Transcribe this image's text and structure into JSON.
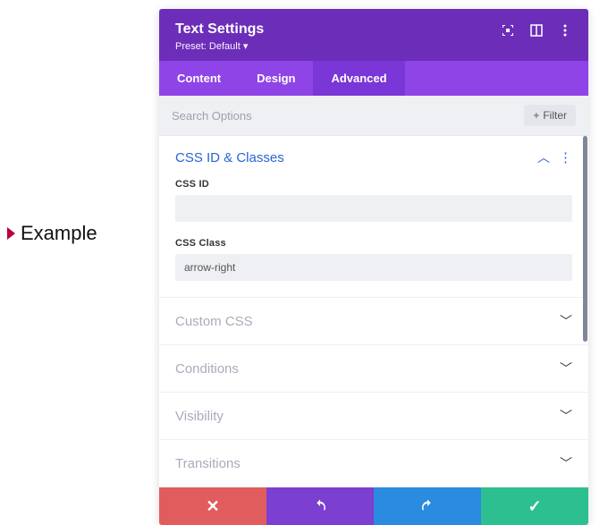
{
  "example_label": "Example",
  "header": {
    "title": "Text Settings",
    "preset_label": "Preset: Default",
    "preset_caret": "▾"
  },
  "tabs": {
    "content": "Content",
    "design": "Design",
    "advanced": "Advanced"
  },
  "search": {
    "placeholder": "Search Options",
    "filter_label": "Filter",
    "filter_plus": "+"
  },
  "sections": {
    "css_id_classes": {
      "title": "CSS ID & Classes",
      "css_id_label": "CSS ID",
      "css_id_value": "",
      "css_class_label": "CSS Class",
      "css_class_value": "arrow-right"
    },
    "custom_css": "Custom CSS",
    "conditions": "Conditions",
    "visibility": "Visibility",
    "transitions": "Transitions"
  }
}
